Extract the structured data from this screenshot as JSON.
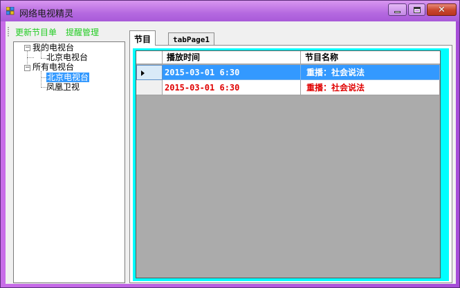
{
  "window": {
    "title": "网络电视精灵",
    "colors": {
      "frame": "#b569e0",
      "close": "#c8452c"
    }
  },
  "menu": {
    "update_label": "更新节目单",
    "remind_label": "提醒管理",
    "color": "#22cc22"
  },
  "tree": {
    "nodes": [
      {
        "label": "我的电视台",
        "expanded": true,
        "children": [
          {
            "label": "北京电视台"
          }
        ]
      },
      {
        "label": "所有电视台",
        "expanded": true,
        "children": [
          {
            "label": "北京电视台",
            "selected": true
          },
          {
            "label": "凤凰卫视"
          }
        ]
      }
    ]
  },
  "tabs": [
    {
      "label": "节目",
      "active": true
    },
    {
      "label": "tabPage1",
      "active": false
    }
  ],
  "grid": {
    "columns": [
      "播放时间",
      "节目名称"
    ],
    "rows": [
      {
        "time": "2015-03-01  6:30",
        "name": "重播：社会说法",
        "selected": true
      },
      {
        "time": "2015-03-01  6:30",
        "name": "重播：社会说法",
        "selected": false
      }
    ],
    "colors": {
      "panel": "#00ffff",
      "selection": "#3399ff",
      "row_text": "#e00000",
      "background": "#ababab"
    }
  }
}
